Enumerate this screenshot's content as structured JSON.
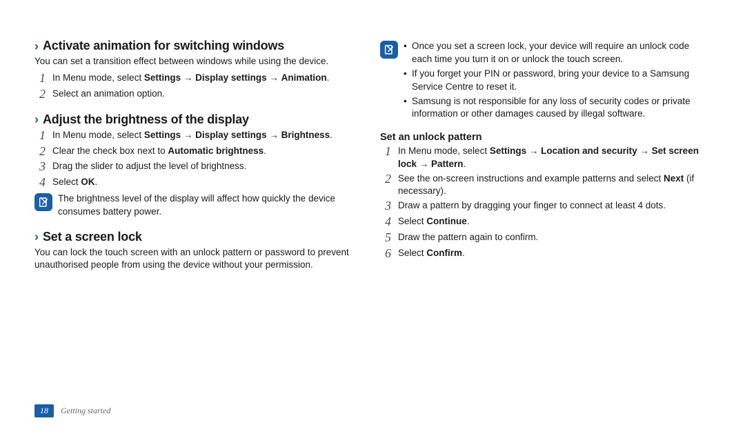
{
  "left": {
    "section1": {
      "title": "Activate animation for switching windows",
      "desc": "You can set a transition effect between windows while using the device.",
      "steps": [
        {
          "num": "1",
          "html": "In Menu mode, select <b>Settings</b> → <b>Display settings</b> → <b>Animation</b>."
        },
        {
          "num": "2",
          "html": "Select an animation option."
        }
      ]
    },
    "section2": {
      "title": "Adjust the brightness of the display",
      "steps": [
        {
          "num": "1",
          "html": "In Menu mode, select <b>Settings</b> → <b>Display settings</b> → <b>Brightness</b>."
        },
        {
          "num": "2",
          "html": "Clear the check box next to <b>Automatic brightness</b>."
        },
        {
          "num": "3",
          "html": "Drag the slider to adjust the level of brightness."
        },
        {
          "num": "4",
          "html": "Select <b>OK</b>."
        }
      ],
      "note": "The brightness level of the display will affect how quickly the device consumes battery power."
    },
    "section3": {
      "title": "Set a screen lock",
      "desc": "You can lock the touch screen with an unlock pattern or password to prevent unauthorised people from using the device without your permission."
    }
  },
  "right": {
    "note_items": [
      "Once you set a screen lock, your device will require an unlock code each time you turn it on or unlock the touch screen.",
      "If you forget your PIN or password, bring your device to a Samsung Service Centre to reset it.",
      "Samsung is not responsible for any loss of security codes or private information or other damages caused by illegal software."
    ],
    "sub": {
      "title": "Set an unlock pattern",
      "steps": [
        {
          "num": "1",
          "html": "In Menu mode, select <b>Settings</b> → <b>Location and security</b> → <b>Set screen lock</b> → <b>Pattern</b>."
        },
        {
          "num": "2",
          "html": "See the on-screen instructions and example patterns and select <b>Next</b> (if necessary)."
        },
        {
          "num": "3",
          "html": "Draw a pattern by dragging your finger to connect at least 4 dots."
        },
        {
          "num": "4",
          "html": "Select <b>Continue</b>."
        },
        {
          "num": "5",
          "html": "Draw the pattern again to confirm."
        },
        {
          "num": "6",
          "html": "Select <b>Confirm</b>."
        }
      ]
    }
  },
  "footer": {
    "page": "18",
    "label": "Getting started"
  }
}
